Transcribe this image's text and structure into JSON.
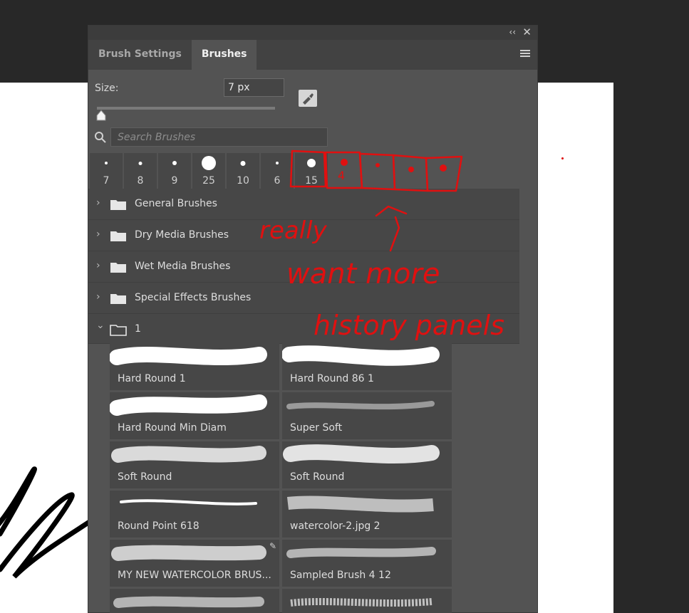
{
  "panel": {
    "collapse_glyph": "‹‹",
    "close_glyph": "✕",
    "tabs": [
      {
        "label": "Brush Settings"
      },
      {
        "label": "Brushes"
      }
    ],
    "size_label": "Size:",
    "size_value": "7 px",
    "search_placeholder": "Search Brushes",
    "presets": [
      {
        "label": "7"
      },
      {
        "label": "8"
      },
      {
        "label": "9"
      },
      {
        "label": "25"
      },
      {
        "label": "10"
      },
      {
        "label": "6"
      },
      {
        "label": "15"
      }
    ],
    "groups": [
      {
        "name": "General Brushes"
      },
      {
        "name": "Dry Media Brushes"
      },
      {
        "name": "Wet Media Brushes"
      },
      {
        "name": "Special Effects Brushes"
      },
      {
        "name": "1"
      }
    ],
    "brushes": [
      {
        "name": "Hard Round 1"
      },
      {
        "name": "Hard Round 86 1"
      },
      {
        "name": "Hard Round Min Diam"
      },
      {
        "name": "Super Soft"
      },
      {
        "name": "Soft Round"
      },
      {
        "name": "Soft Round"
      },
      {
        "name": "Round Point 618"
      },
      {
        "name": "watercolor-2.jpg 2"
      },
      {
        "name": "MY NEW WATERCOLOR BRUS..."
      },
      {
        "name": "Sampled Brush 4 12"
      },
      {
        "name": ""
      },
      {
        "name": ""
      }
    ]
  },
  "annotation": {
    "text_lines": [
      "really",
      "want more",
      "history panels"
    ],
    "color": "#e01010"
  },
  "colors": {
    "panel_bg": "#535353",
    "tab_bar": "#424242",
    "canvas": "#ffffff",
    "background": "#282828"
  }
}
